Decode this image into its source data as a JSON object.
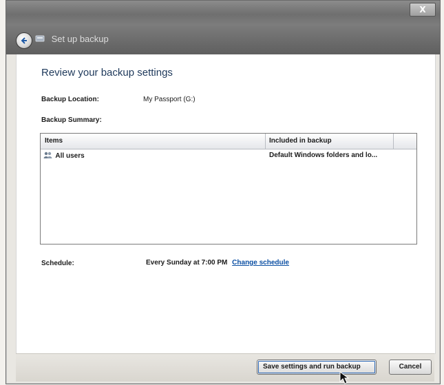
{
  "window": {
    "close_label": "X",
    "nav_title": "Set up backup"
  },
  "main": {
    "heading": "Review your backup settings",
    "backup_location_label": "Backup Location:",
    "backup_location_value": "My Passport (G:)",
    "backup_summary_label": "Backup Summary:",
    "schedule_label": "Schedule:",
    "schedule_value": "Every Sunday at 7:00 PM",
    "change_schedule_link": "Change schedule"
  },
  "summary_table": {
    "columns": [
      "Items",
      "Included in backup"
    ],
    "rows": [
      {
        "item": "All users",
        "included": "Default Windows folders and lo..."
      }
    ]
  },
  "footer": {
    "save_button": "Save settings and run backup",
    "cancel_button": "Cancel"
  },
  "icons": {
    "back": "back-arrow-icon",
    "backup": "backup-icon",
    "users": "users-icon",
    "cursor": "mouse-cursor-icon"
  }
}
